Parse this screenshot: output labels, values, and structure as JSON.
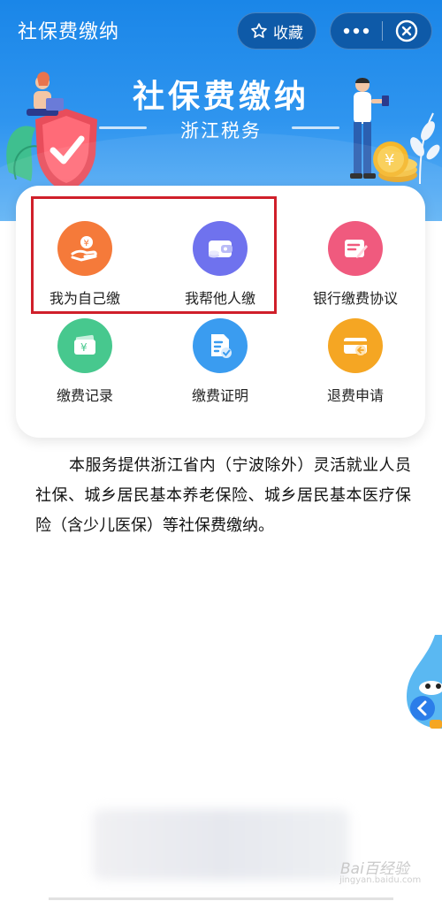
{
  "header": {
    "title": "社保费缴纳",
    "favorite_label": "收藏"
  },
  "banner": {
    "title": "社保费缴纳",
    "subtitle": "浙江税务"
  },
  "services": [
    {
      "label": "我为自己缴",
      "icon": "hand-coin-icon",
      "color": "#f57a3a"
    },
    {
      "label": "我帮他人缴",
      "icon": "wallet-icon",
      "color": "#6f72ee"
    },
    {
      "label": "银行缴费协议",
      "icon": "edit-document-icon",
      "color": "#f05a7e"
    },
    {
      "label": "缴费记录",
      "icon": "money-record-icon",
      "color": "#47c88e"
    },
    {
      "label": "缴费证明",
      "icon": "certificate-icon",
      "color": "#3a9cf0"
    },
    {
      "label": "退费申请",
      "icon": "refund-card-icon",
      "color": "#f5a623"
    }
  ],
  "description": "本服务提供浙江省内（宁波除外）灵活就业人员社保、城乡居民基本养老保险、城乡居民基本医疗保险（含少儿医保）等社保费缴纳。",
  "watermark": {
    "text": "Bai百经验",
    "url": "jingyan.baidu.com"
  }
}
